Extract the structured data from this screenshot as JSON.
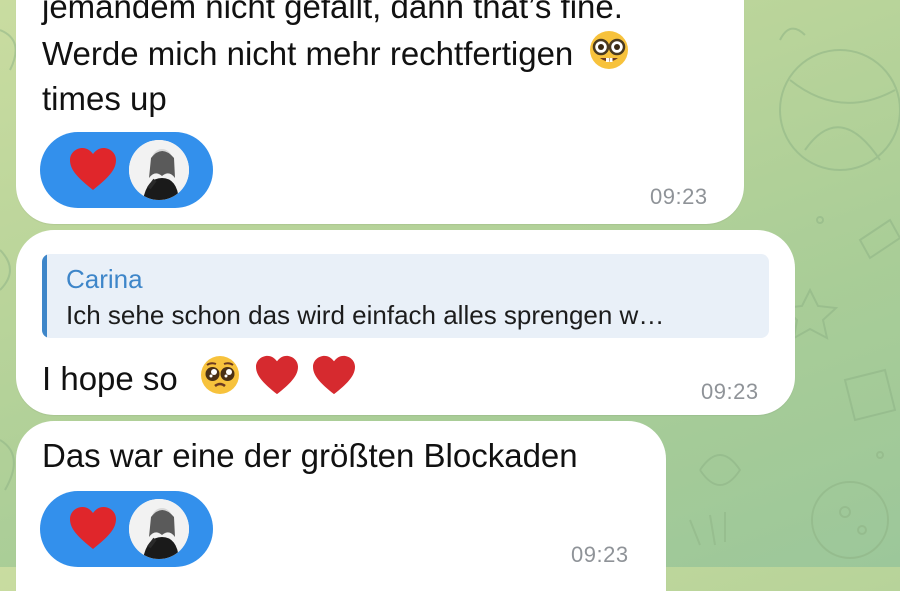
{
  "colors": {
    "wallpaper": "#b9d49a",
    "bubble": "#ffffff",
    "reaction_pill": "#3390ec",
    "reply_accent": "#3e86c9",
    "reply_background": "#e9f0f8",
    "timestamp": "#8f9398"
  },
  "messages": [
    {
      "lines": [
        "jemandem nicht gefällt, dann that’s fine.",
        "Werde mich nicht mehr rechtfertigen",
        "times up"
      ],
      "emoji": "🤓",
      "emoji_icon": "nerd-face-icon",
      "reaction": {
        "icon": "red-heart-icon",
        "avatar": "reactor-avatar"
      },
      "time": "09:23"
    },
    {
      "reply": {
        "author": "Carina",
        "text": "Ich sehe schon das wird einfach alles sprengen w…"
      },
      "text": "I hope so",
      "emoji_icons": [
        "pleading-face-icon",
        "red-heart-icon",
        "red-heart-icon"
      ],
      "time": "09:23"
    },
    {
      "text": "Das war eine der größten Blockaden",
      "reaction": {
        "icon": "red-heart-icon",
        "avatar": "reactor-avatar"
      },
      "time": "09:23"
    }
  ]
}
